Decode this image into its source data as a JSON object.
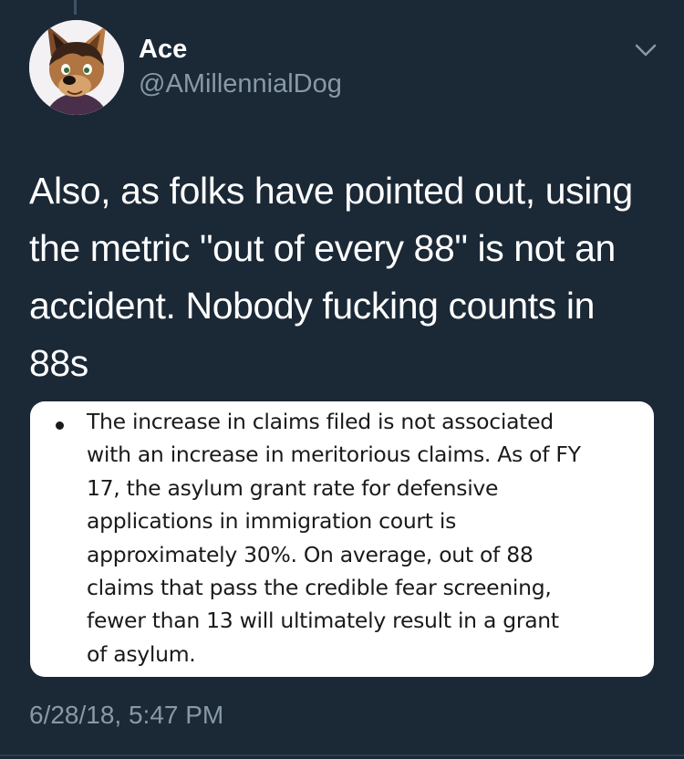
{
  "tweet": {
    "author": {
      "display_name": "Ace",
      "handle": "@AMillennialDog",
      "avatar_icon": "cartoon-dog-avatar"
    },
    "menu_icon": "chevron-down-icon",
    "text_lines": [
      "Also, as folks have pointed out, using",
      "the metric \"out of every 88\" is not an",
      "accident. Nobody fucking counts in",
      "88s"
    ],
    "media": {
      "lines": [
        "The increase in claims filed is not associated",
        "with an increase in meritorious claims. As of FY",
        "17, the asylum grant rate for defensive",
        "applications in immigration court is",
        "approximately 30%. On average, out of 88",
        "claims that pass the credible fear screening,",
        "fewer than 13 will ultimately result in a grant",
        "of asylum."
      ]
    },
    "timestamp": "6/28/18, 5:47 PM"
  },
  "colors": {
    "background": "#1b2836",
    "text_primary": "#ffffff",
    "text_secondary": "#8899a6",
    "card_background": "#ffffff"
  }
}
